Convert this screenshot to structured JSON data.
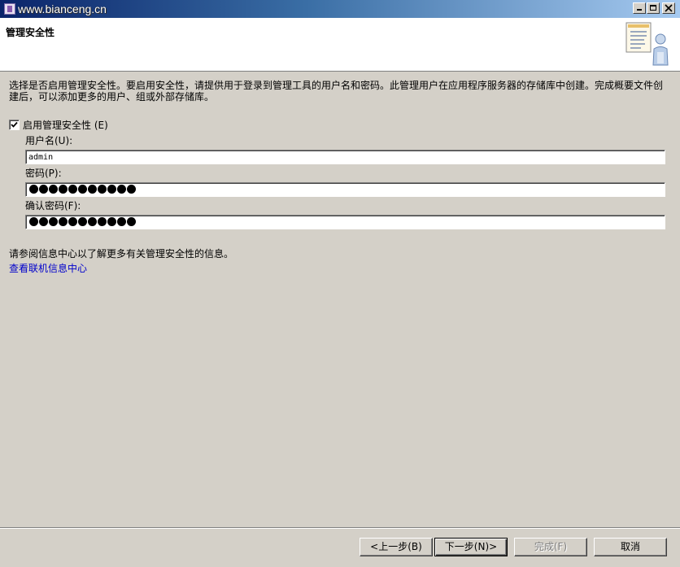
{
  "window": {
    "title": "",
    "watermark": "www.bianceng.cn"
  },
  "banner": {
    "title": "管理安全性",
    "icon": "wizard-document-user-icon"
  },
  "description": "选择是否启用管理安全性。要启用安全性，请提供用于登录到管理工具的用户名和密码。此管理用户在应用程序服务器的存储库中创建。完成概要文件创建后，可以添加更多的用户、组或外部存储库。",
  "security": {
    "enable_label": "启用管理安全性 (E)",
    "enabled": true,
    "username_label": "用户名(U):",
    "username_value": "admin",
    "password_label": "密码(P):",
    "password_dots": 11,
    "confirm_label": "确认密码(F):",
    "confirm_dots": 11
  },
  "info": {
    "text": "请参阅信息中心以了解更多有关管理安全性的信息。",
    "link": "查看联机信息中心"
  },
  "buttons": {
    "back": "<上一步(B)",
    "next": "下一步(N)>",
    "finish": "完成(F)",
    "cancel": "取消"
  },
  "colors": {
    "titlebar_start": "#0a246a",
    "face": "#d4d0c8",
    "link": "#0000cc"
  }
}
